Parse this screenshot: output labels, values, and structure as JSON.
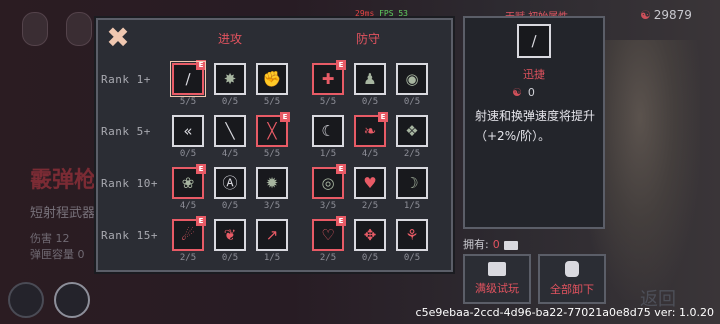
{
  "hud": {
    "ping": "29ms",
    "fps": "FPS 53",
    "currency": "29879",
    "top_tabs": "天赋 初始属性"
  },
  "background": {
    "weapon_name": "霰弹枪",
    "weapon_type": "短射程武器",
    "stat1_label": "伤害",
    "stat1_value": "12",
    "stat2_label": "弹匣容量",
    "stat2_value": "0",
    "back_label": "返回"
  },
  "panel": {
    "close_glyph": "✖",
    "col_attack": "进攻",
    "col_defense": "防守",
    "ranks": [
      {
        "label": "Rank 1+",
        "cells": [
          {
            "icon": "∕",
            "color": "#d9d9df",
            "level": "5/5",
            "equipped": true,
            "selected": true
          },
          {
            "icon": "✸",
            "color": "#a7b5a0",
            "level": "0/5",
            "equipped": false
          },
          {
            "icon": "✊",
            "color": "#a7b5a0",
            "level": "5/5",
            "equipped": false
          },
          {
            "icon": "✚",
            "color": "#e85b66",
            "level": "5/5",
            "equipped": true
          },
          {
            "icon": "♟",
            "color": "#a7b5a0",
            "level": "0/5",
            "equipped": false
          },
          {
            "icon": "◉",
            "color": "#a7b5a0",
            "level": "0/5",
            "equipped": false
          }
        ]
      },
      {
        "label": "Rank 5+",
        "cells": [
          {
            "icon": "«",
            "color": "#d9d9df",
            "level": "0/5",
            "equipped": false
          },
          {
            "icon": "╲",
            "color": "#d9d9df",
            "level": "4/5",
            "equipped": false
          },
          {
            "icon": "╳",
            "color": "#e85b66",
            "level": "5/5",
            "equipped": true
          },
          {
            "icon": "☾",
            "color": "#d9d9df",
            "level": "1/5",
            "equipped": false
          },
          {
            "icon": "❧",
            "color": "#e85b66",
            "level": "4/5",
            "equipped": true
          },
          {
            "icon": "❖",
            "color": "#a7b5a0",
            "level": "2/5",
            "equipped": false
          }
        ]
      },
      {
        "label": "Rank 10+",
        "cells": [
          {
            "icon": "❀",
            "color": "#a7b5a0",
            "level": "4/5",
            "equipped": true
          },
          {
            "icon": "Ⓐ",
            "color": "#d9d9df",
            "level": "0/5",
            "equipped": false
          },
          {
            "icon": "✹",
            "color": "#a7b5a0",
            "level": "3/5",
            "equipped": false
          },
          {
            "icon": "◎",
            "color": "#a7b5a0",
            "level": "3/5",
            "equipped": true
          },
          {
            "icon": "♥",
            "color": "#e85b66",
            "level": "2/5",
            "equipped": false
          },
          {
            "icon": "☽",
            "color": "#a7b5a0",
            "level": "1/5",
            "equipped": false
          }
        ]
      },
      {
        "label": "Rank 15+",
        "cells": [
          {
            "icon": "☄",
            "color": "#e85b66",
            "level": "2/5",
            "equipped": true
          },
          {
            "icon": "❦",
            "color": "#e85b66",
            "level": "0/5",
            "equipped": false
          },
          {
            "icon": "↗",
            "color": "#e85b66",
            "level": "1/5",
            "equipped": false
          },
          {
            "icon": "♡",
            "color": "#e85b66",
            "level": "2/5",
            "equipped": true
          },
          {
            "icon": "✥",
            "color": "#e85b66",
            "level": "0/5",
            "equipped": false
          },
          {
            "icon": "⚘",
            "color": "#e85b66",
            "level": "0/5",
            "equipped": false
          }
        ]
      }
    ]
  },
  "info": {
    "icon": "∕",
    "name": "迅捷",
    "cost": "0",
    "description": "射速和换弹速度将提升（+2%/阶）。"
  },
  "owned": {
    "label": "拥有:",
    "value": "0"
  },
  "buttons": {
    "trial": "满级试玩",
    "unequip_all": "全部卸下"
  },
  "footer": {
    "build": "c5e9ebaa-2ccd-4d96-ba22-77021a0e8d75 ver: 1.0.20"
  },
  "colors": {
    "accent_red": "#e2535f",
    "equipped_border": "#e85b66",
    "cell_border": "#d9d9df"
  }
}
